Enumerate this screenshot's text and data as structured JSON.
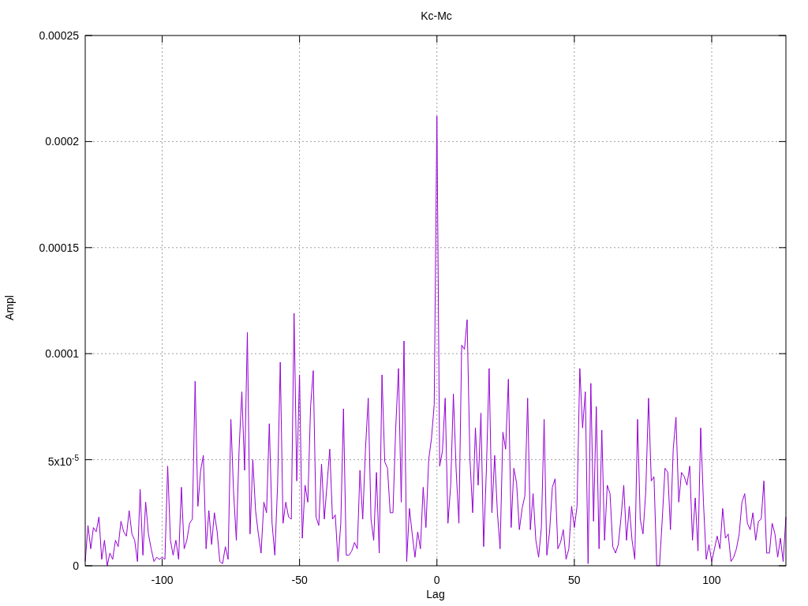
{
  "chart_data": {
    "type": "line",
    "title": "Kc-Mc",
    "xlabel": "Lag",
    "ylabel": "Ampl",
    "xlim": [
      -128,
      127
    ],
    "ylim": [
      0,
      0.00025
    ],
    "xticks": [
      -100,
      -50,
      0,
      50,
      100
    ],
    "grid": true,
    "x": [
      -128,
      -127,
      -126,
      -125,
      -124,
      -123,
      -122,
      -121,
      -120,
      -119,
      -118,
      -117,
      -116,
      -115,
      -114,
      -113,
      -112,
      -111,
      -110,
      -109,
      -108,
      -107,
      -106,
      -105,
      -104,
      -103,
      -102,
      -101,
      -100,
      -99,
      -98,
      -97,
      -96,
      -95,
      -94,
      -93,
      -92,
      -91,
      -90,
      -89,
      -88,
      -87,
      -86,
      -85,
      -84,
      -83,
      -82,
      -81,
      -80,
      -79,
      -78,
      -77,
      -76,
      -75,
      -74,
      -73,
      -72,
      -71,
      -70,
      -69,
      -68,
      -67,
      -66,
      -65,
      -64,
      -63,
      -62,
      -61,
      -60,
      -59,
      -58,
      -57,
      -56,
      -55,
      -54,
      -53,
      -52,
      -51,
      -50,
      -49,
      -48,
      -47,
      -46,
      -45,
      -44,
      -43,
      -42,
      -41,
      -40,
      -39,
      -38,
      -37,
      -36,
      -35,
      -34,
      -33,
      -32,
      -31,
      -30,
      -29,
      -28,
      -27,
      -26,
      -25,
      -24,
      -23,
      -22,
      -21,
      -20,
      -19,
      -18,
      -17,
      -16,
      -15,
      -14,
      -13,
      -12,
      -11,
      -10,
      -9,
      -8,
      -7,
      -6,
      -5,
      -4,
      -3,
      -2,
      -1,
      0,
      1,
      2,
      3,
      4,
      5,
      6,
      7,
      8,
      9,
      10,
      11,
      12,
      13,
      14,
      15,
      16,
      17,
      18,
      19,
      20,
      21,
      22,
      23,
      24,
      25,
      26,
      27,
      28,
      29,
      30,
      31,
      32,
      33,
      34,
      35,
      36,
      37,
      38,
      39,
      40,
      41,
      42,
      43,
      44,
      45,
      46,
      47,
      48,
      49,
      50,
      51,
      52,
      53,
      54,
      55,
      56,
      57,
      58,
      59,
      60,
      61,
      62,
      63,
      64,
      65,
      66,
      67,
      68,
      69,
      70,
      71,
      72,
      73,
      74,
      75,
      76,
      77,
      78,
      79,
      80,
      81,
      82,
      83,
      84,
      85,
      86,
      87,
      88,
      89,
      90,
      91,
      92,
      93,
      94,
      95,
      96,
      97,
      98,
      99,
      100,
      101,
      102,
      103,
      104,
      105,
      106,
      107,
      108,
      109,
      110,
      111,
      112,
      113,
      114,
      115,
      116,
      117,
      118,
      119,
      120,
      121,
      122,
      123,
      124,
      125,
      126,
      127
    ],
    "yticks": [
      0,
      {
        "value": 5e-05,
        "label": "5x10$^{-5}$"
      },
      0.0001,
      0.00015,
      0.0002,
      0.00025
    ],
    "series": [
      {
        "color": "#9400d3",
        "values": [
          2e-06,
          1.9e-05,
          8e-06,
          1.8e-05,
          1.6e-05,
          2.3e-05,
          3e-06,
          1.2e-05,
          0,
          6e-06,
          3e-06,
          1.2e-05,
          9e-06,
          2.1e-05,
          1.6e-05,
          1.4e-05,
          2.6e-05,
          1.5e-05,
          1.2e-05,
          2e-06,
          3.6e-05,
          5e-06,
          3e-05,
          1.5e-05,
          8e-06,
          2e-06,
          4e-06,
          3e-06,
          4e-06,
          3e-06,
          4.7e-05,
          1.2e-05,
          5e-06,
          1.2e-05,
          3e-06,
          3.7e-05,
          8e-06,
          1.2e-05,
          2e-05,
          2.2e-05,
          8.7e-05,
          2.8e-05,
          4.5e-05,
          5.2e-05,
          8e-06,
          2.6e-05,
          1e-05,
          2.5e-05,
          1.6e-05,
          2e-06,
          1e-06,
          9e-06,
          3e-06,
          6.9e-05,
          3.5e-05,
          1.2e-05,
          5.5e-05,
          8.2e-05,
          4.5e-05,
          0.00011,
          1.5e-05,
          5e-05,
          2.6e-05,
          1.5e-05,
          6e-06,
          3e-05,
          2.5e-05,
          6.7e-05,
          2e-05,
          5e-06,
          3.8e-05,
          9.6e-05,
          2e-05,
          3e-05,
          2.3e-05,
          2.2e-05,
          0.000119,
          4e-05,
          9e-05,
          1.3e-05,
          3.8e-05,
          3e-05,
          7.5e-05,
          9.2e-05,
          2.3e-05,
          1.9e-05,
          4.8e-05,
          2.2e-05,
          3.8e-05,
          5.5e-05,
          2.2e-05,
          2.4e-05,
          2e-06,
          2e-05,
          7.4e-05,
          5e-06,
          5e-06,
          7e-06,
          1.1e-05,
          8e-06,
          4.5e-05,
          2.2e-05,
          5.5e-05,
          7.9e-05,
          2.2e-05,
          1.2e-05,
          4.4e-05,
          6e-06,
          9e-05,
          4.9e-05,
          4.6e-05,
          2.5e-05,
          2.5e-05,
          6.5e-05,
          9.3e-05,
          3e-05,
          0.000106,
          2e-06,
          2.7e-05,
          1.5e-05,
          4e-06,
          1.6e-05,
          8e-06,
          3.7e-05,
          1.8e-05,
          5e-05,
          6e-05,
          7.6e-05,
          0.000212,
          4.7e-05,
          5.4e-05,
          7.9e-05,
          2e-05,
          3.8e-05,
          8.1e-05,
          4.5e-05,
          2e-05,
          0.000104,
          0.000102,
          0.000116,
          5.1e-05,
          2.5e-05,
          6.5e-05,
          3.8e-05,
          7.2e-05,
          9e-06,
          4.5e-05,
          9.3e-05,
          2.5e-05,
          5.2e-05,
          2.5e-05,
          8e-06,
          6.3e-05,
          5.5e-05,
          8.8e-05,
          1.8e-05,
          4.6e-05,
          3.9e-05,
          1.7e-05,
          2.7e-05,
          3.3e-05,
          7.9e-05,
          1.7e-05,
          3.4e-05,
          1.2e-05,
          4e-06,
          1.8e-05,
          6.9e-05,
          5e-06,
          1.6e-05,
          3.7e-05,
          4.1e-05,
          8e-06,
          1.1e-05,
          1.7e-05,
          3e-06,
          8e-06,
          2.8e-05,
          1.8e-05,
          2.8e-05,
          9.3e-05,
          6.5e-05,
          8.2e-05,
          1e-06,
          8.6e-05,
          2.1e-05,
          7.5e-05,
          8e-06,
          6.4e-05,
          1.2e-05,
          3.8e-05,
          3.4e-05,
          9e-06,
          6e-06,
          1e-05,
          2.3e-05,
          3.8e-05,
          1.2e-05,
          2.8e-05,
          1.2e-05,
          3e-06,
          6.9e-05,
          2.2e-05,
          1.5e-05,
          3.5e-05,
          7.9e-05,
          4e-05,
          4.2e-05,
          0,
          0,
          2.2e-05,
          4.6e-05,
          4.4e-05,
          1.7e-05,
          5.5e-05,
          7e-05,
          3e-05,
          4.4e-05,
          4.2e-05,
          3.8e-05,
          4.7e-05,
          1.2e-05,
          3.2e-05,
          7e-06,
          6.5e-05,
          3e-05,
          3e-06,
          1e-05,
          2e-06,
          8e-06,
          1.4e-05,
          8e-06,
          2.7e-05,
          1.3e-05,
          1.5e-05,
          2e-06,
          4e-06,
          8e-06,
          1.5e-05,
          3e-05,
          3.4e-05,
          2e-05,
          1.7e-05,
          2.5e-05,
          1.2e-05,
          2.1e-05,
          2.2e-05,
          4e-05,
          6e-06,
          6e-06,
          2e-05,
          1.5e-05,
          4e-06,
          1.3e-05,
          2e-06,
          2.3e-05
        ]
      }
    ]
  }
}
